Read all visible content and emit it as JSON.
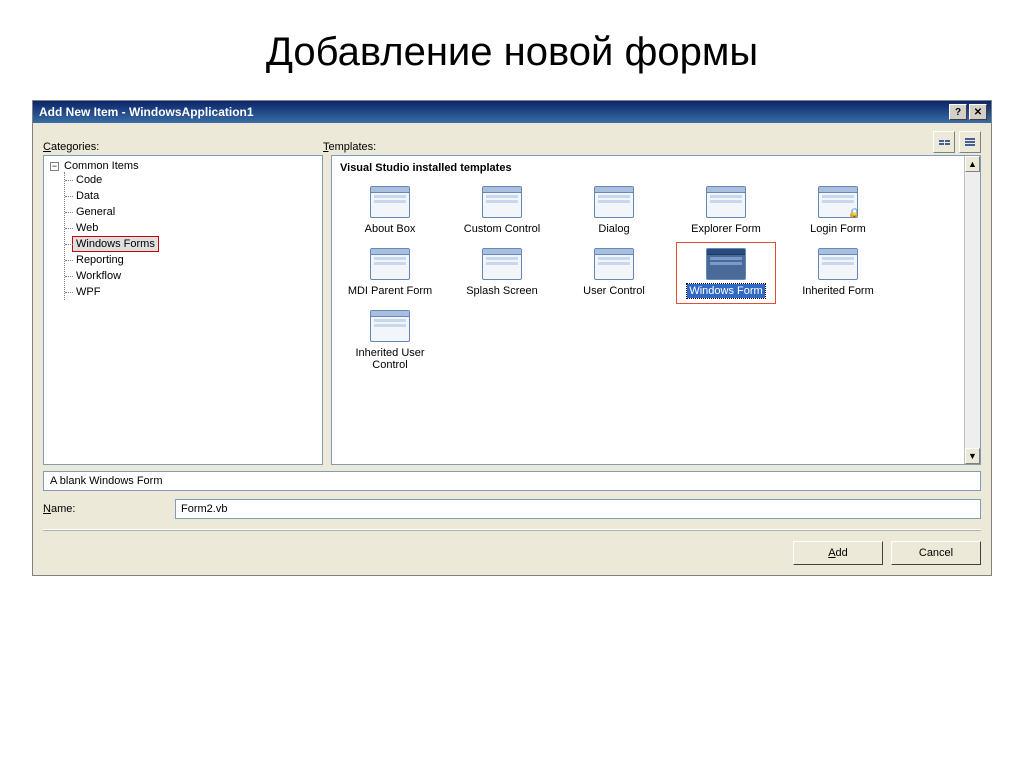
{
  "slide_title": "Добавление новой формы",
  "dialog_title": "Add New Item - WindowsApplication1",
  "labels": {
    "categories": "Categories:",
    "templates": "Templates:",
    "name": "Name:",
    "add": "Add",
    "cancel": "Cancel"
  },
  "tree": {
    "root": "Common Items",
    "items": [
      "Code",
      "Data",
      "General",
      "Web",
      "Windows Forms",
      "Reporting",
      "Workflow",
      "WPF"
    ],
    "selected": "Windows Forms"
  },
  "templates_header": "Visual Studio installed templates",
  "templates": [
    {
      "label": "About Box"
    },
    {
      "label": "Custom Control"
    },
    {
      "label": "Dialog"
    },
    {
      "label": "Explorer Form"
    },
    {
      "label": "Login Form",
      "lock": true
    },
    {
      "label": "MDI Parent Form"
    },
    {
      "label": "Splash Screen"
    },
    {
      "label": "User Control"
    },
    {
      "label": "Windows Form",
      "selected": true,
      "dark": true
    },
    {
      "label": "Inherited Form"
    },
    {
      "label": "Inherited User Control"
    }
  ],
  "description": "A blank Windows Form",
  "name_value": "Form2.vb"
}
